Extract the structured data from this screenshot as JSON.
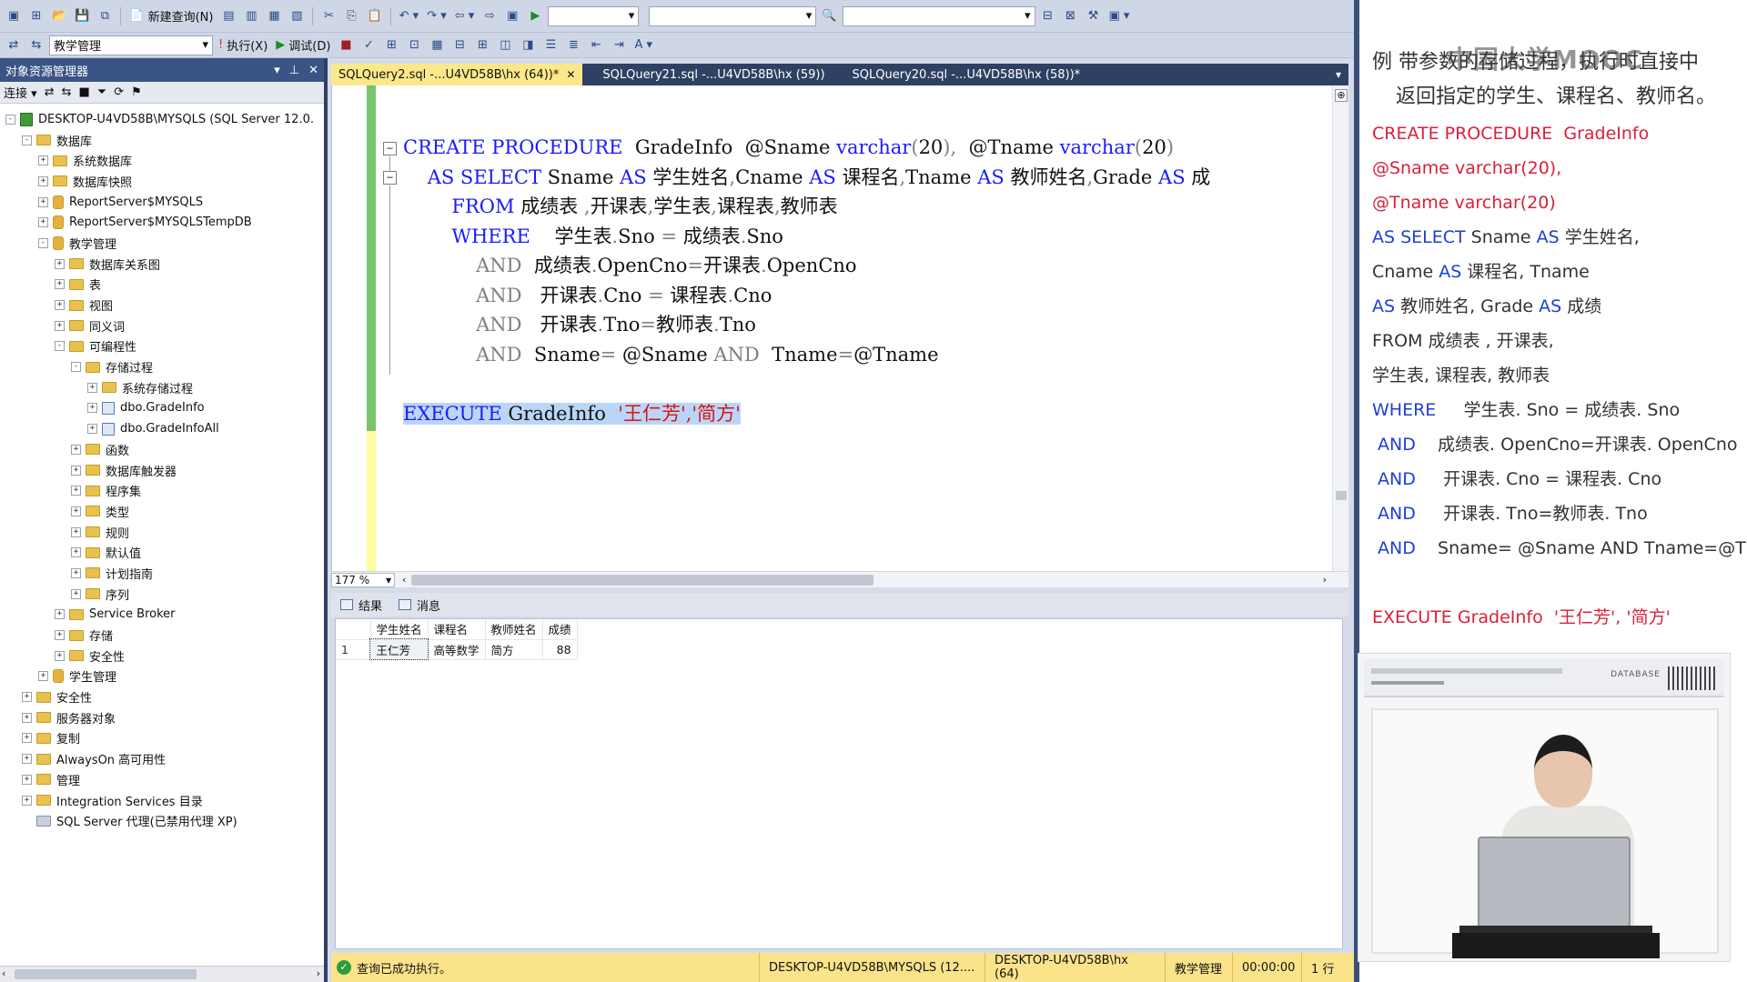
{
  "toolbar1": {
    "new_query": "新建查询(N)",
    "combo1": "",
    "combo2": "",
    "combo3": ""
  },
  "toolbar2": {
    "database": "教学管理",
    "execute": "执行(X)",
    "debug": "调试(D)"
  },
  "object_explorer": {
    "title": "对象资源管理器",
    "connect": "连接",
    "tree": [
      {
        "level": 0,
        "exp": "-",
        "icon": "server",
        "label": "DESKTOP-U4VD58B\\MYSQLS (SQL Server 12.0."
      },
      {
        "level": 1,
        "exp": "-",
        "icon": "folder",
        "label": "数据库"
      },
      {
        "level": 2,
        "exp": "+",
        "icon": "folder",
        "label": "系统数据库"
      },
      {
        "level": 2,
        "exp": "+",
        "icon": "folder",
        "label": "数据库快照"
      },
      {
        "level": 2,
        "exp": "+",
        "icon": "db",
        "label": "ReportServer$MYSQLS"
      },
      {
        "level": 2,
        "exp": "+",
        "icon": "db",
        "label": "ReportServer$MYSQLSTempDB"
      },
      {
        "level": 2,
        "exp": "-",
        "icon": "db",
        "label": "教学管理"
      },
      {
        "level": 3,
        "exp": "+",
        "icon": "folder",
        "label": "数据库关系图"
      },
      {
        "level": 3,
        "exp": "+",
        "icon": "folder",
        "label": "表"
      },
      {
        "level": 3,
        "exp": "+",
        "icon": "folder",
        "label": "视图"
      },
      {
        "level": 3,
        "exp": "+",
        "icon": "folder",
        "label": "同义词"
      },
      {
        "level": 3,
        "exp": "-",
        "icon": "folder",
        "label": "可编程性"
      },
      {
        "level": 4,
        "exp": "-",
        "icon": "folder",
        "label": "存储过程"
      },
      {
        "level": 5,
        "exp": "+",
        "icon": "folder",
        "label": "系统存储过程"
      },
      {
        "level": 5,
        "exp": "+",
        "icon": "proc",
        "label": "dbo.GradeInfo"
      },
      {
        "level": 5,
        "exp": "+",
        "icon": "proc",
        "label": "dbo.GradeInfoAll"
      },
      {
        "level": 4,
        "exp": "+",
        "icon": "folder",
        "label": "函数"
      },
      {
        "level": 4,
        "exp": "+",
        "icon": "folder",
        "label": "数据库触发器"
      },
      {
        "level": 4,
        "exp": "+",
        "icon": "folder",
        "label": "程序集"
      },
      {
        "level": 4,
        "exp": "+",
        "icon": "folder",
        "label": "类型"
      },
      {
        "level": 4,
        "exp": "+",
        "icon": "folder",
        "label": "规则"
      },
      {
        "level": 4,
        "exp": "+",
        "icon": "folder",
        "label": "默认值"
      },
      {
        "level": 4,
        "exp": "+",
        "icon": "folder",
        "label": "计划指南"
      },
      {
        "level": 4,
        "exp": "+",
        "icon": "folder",
        "label": "序列"
      },
      {
        "level": 3,
        "exp": "+",
        "icon": "folder",
        "label": "Service Broker"
      },
      {
        "level": 3,
        "exp": "+",
        "icon": "folder",
        "label": "存储"
      },
      {
        "level": 3,
        "exp": "+",
        "icon": "folder",
        "label": "安全性"
      },
      {
        "level": 2,
        "exp": "+",
        "icon": "db",
        "label": "学生管理"
      },
      {
        "level": 1,
        "exp": "+",
        "icon": "folder",
        "label": "安全性"
      },
      {
        "level": 1,
        "exp": "+",
        "icon": "folder",
        "label": "服务器对象"
      },
      {
        "level": 1,
        "exp": "+",
        "icon": "folder",
        "label": "复制"
      },
      {
        "level": 1,
        "exp": "+",
        "icon": "folder",
        "label": "AlwaysOn 高可用性"
      },
      {
        "level": 1,
        "exp": "+",
        "icon": "folder",
        "label": "管理"
      },
      {
        "level": 1,
        "exp": "+",
        "icon": "folder",
        "label": "Integration Services 目录"
      },
      {
        "level": 1,
        "exp": "",
        "icon": "agent",
        "label": "SQL Server 代理(已禁用代理 XP)"
      }
    ]
  },
  "tabs": [
    {
      "label": "SQLQuery2.sql -...U4VD58B\\hx (64))*",
      "active": true
    },
    {
      "label": "SQLQuery21.sql -...U4VD58B\\hx (59))",
      "active": false
    },
    {
      "label": "SQLQuery20.sql -...U4VD58B\\hx (58))*",
      "active": false
    }
  ],
  "editor": {
    "zoom": "177 %",
    "execute_line": {
      "kw": "EXECUTE",
      "proc": " GradeInfo  ",
      "args": "'王仁芳','简方'"
    }
  },
  "results": {
    "tab_results": "结果",
    "tab_messages": "消息",
    "columns": [
      "学生姓名",
      "课程名",
      "教师姓名",
      "成绩"
    ],
    "rows": [
      {
        "n": "1",
        "cells": [
          "王仁芳",
          "高等数学",
          "简方",
          "88"
        ]
      }
    ]
  },
  "status": {
    "message": "查询已成功执行。",
    "server": "DESKTOP-U4VD58B\\MYSQLS (12....",
    "user": "DESKTOP-U4VD58B\\hx (64)",
    "db": "教学管理",
    "time": "00:00:00",
    "rows": "1 行"
  },
  "slide": {
    "line1": "例   带参数的存储过程，执行时直接中",
    "line2": "返回指定的学生、课程名、教师名。",
    "logo": "中国大学MOOC",
    "banner_text": "DATABASE"
  }
}
